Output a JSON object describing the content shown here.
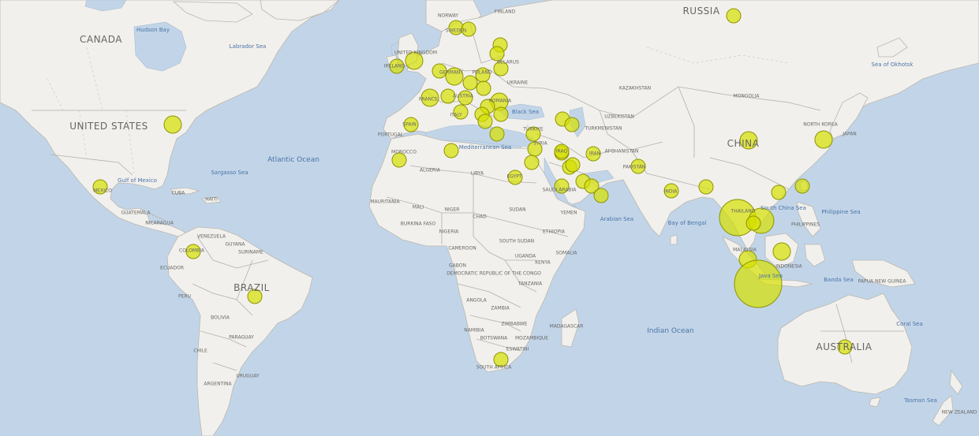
{
  "map": {
    "country_labels": [
      {
        "id": "canada",
        "text": "CANADA",
        "size": "big"
      },
      {
        "id": "united-states",
        "text": "UNITED STATES",
        "size": "big"
      },
      {
        "id": "russia",
        "text": "RUSSIA",
        "size": "big"
      },
      {
        "id": "china",
        "text": "CHINA",
        "size": "big"
      },
      {
        "id": "brazil",
        "text": "BRAZIL",
        "size": "big"
      },
      {
        "id": "australia",
        "text": "AUSTRALIA",
        "size": "big"
      },
      {
        "id": "norway",
        "text": "NORWAY",
        "size": "small"
      },
      {
        "id": "finland",
        "text": "FINLAND",
        "size": "small"
      },
      {
        "id": "sweden",
        "text": "SWEDEN",
        "size": "small"
      },
      {
        "id": "united-kingdom",
        "text": "UNITED KINGDOM",
        "size": "small"
      },
      {
        "id": "ireland",
        "text": "IRELAND",
        "size": "small"
      },
      {
        "id": "germany",
        "text": "GERMANY",
        "size": "small"
      },
      {
        "id": "poland",
        "text": "POLAND",
        "size": "small"
      },
      {
        "id": "belarus",
        "text": "BELARUS",
        "size": "small"
      },
      {
        "id": "ukraine",
        "text": "UKRAINE",
        "size": "small"
      },
      {
        "id": "france",
        "text": "FRANCE",
        "size": "small"
      },
      {
        "id": "austria",
        "text": "AUSTRIA",
        "size": "small"
      },
      {
        "id": "italy",
        "text": "ITALY",
        "size": "small"
      },
      {
        "id": "spain",
        "text": "SPAIN",
        "size": "small"
      },
      {
        "id": "portugal",
        "text": "PORTUGAL",
        "size": "small"
      },
      {
        "id": "romania",
        "text": "ROMANIA",
        "size": "small"
      },
      {
        "id": "turkiye",
        "text": "TÜRKIYE",
        "size": "small"
      },
      {
        "id": "syria",
        "text": "SYRIA",
        "size": "small"
      },
      {
        "id": "iraq",
        "text": "IRAQ",
        "size": "small"
      },
      {
        "id": "iran",
        "text": "IRAN",
        "size": "small"
      },
      {
        "id": "egypt",
        "text": "EGYPT",
        "size": "small"
      },
      {
        "id": "saudi-arabia",
        "text": "SAUDI ARABIA",
        "size": "small"
      },
      {
        "id": "yemen",
        "text": "YEMEN",
        "size": "small"
      },
      {
        "id": "kazakhstan",
        "text": "KAZAKHSTAN",
        "size": "small"
      },
      {
        "id": "uzbekistan",
        "text": "UZBEKISTAN",
        "size": "small"
      },
      {
        "id": "turkmenistan",
        "text": "TURKMENISTAN",
        "size": "small"
      },
      {
        "id": "afghanistan",
        "text": "AFGHANISTAN",
        "size": "small"
      },
      {
        "id": "pakistan",
        "text": "PAKISTAN",
        "size": "small"
      },
      {
        "id": "india",
        "text": "INDIA",
        "size": "small"
      },
      {
        "id": "mongolia",
        "text": "MONGOLIA",
        "size": "small"
      },
      {
        "id": "north-korea",
        "text": "NORTH KOREA",
        "size": "small"
      },
      {
        "id": "japan",
        "text": "JAPAN",
        "size": "small"
      },
      {
        "id": "thailand",
        "text": "THAILAND",
        "size": "small"
      },
      {
        "id": "malaysia",
        "text": "MALAYSIA",
        "size": "small"
      },
      {
        "id": "philippines",
        "text": "PHILIPPINES",
        "size": "small"
      },
      {
        "id": "indonesia",
        "text": "INDONESIA",
        "size": "small"
      },
      {
        "id": "papua-new-guinea",
        "text": "PAPUA NEW GUINEA",
        "size": "small"
      },
      {
        "id": "new-zealand",
        "text": "NEW ZEALAND",
        "size": "small"
      },
      {
        "id": "morocco",
        "text": "MOROCCO",
        "size": "small"
      },
      {
        "id": "algeria",
        "text": "ALGERIA",
        "size": "small"
      },
      {
        "id": "libya",
        "text": "LIBYA",
        "size": "small"
      },
      {
        "id": "mauritania",
        "text": "MAURITANIA",
        "size": "small"
      },
      {
        "id": "mali",
        "text": "MALI",
        "size": "small"
      },
      {
        "id": "niger",
        "text": "NIGER",
        "size": "small"
      },
      {
        "id": "chad",
        "text": "CHAD",
        "size": "small"
      },
      {
        "id": "sudan",
        "text": "SUDAN",
        "size": "small"
      },
      {
        "id": "burkina-faso",
        "text": "BURKINA FASO",
        "size": "small"
      },
      {
        "id": "nigeria",
        "text": "NIGERIA",
        "size": "small"
      },
      {
        "id": "cameroon",
        "text": "CAMEROON",
        "size": "small"
      },
      {
        "id": "south-sudan",
        "text": "SOUTH SUDAN",
        "size": "small"
      },
      {
        "id": "ethiopia",
        "text": "ETHIOPIA",
        "size": "small"
      },
      {
        "id": "somalia",
        "text": "SOMALIA",
        "size": "small"
      },
      {
        "id": "uganda",
        "text": "UGANDA",
        "size": "small"
      },
      {
        "id": "kenya",
        "text": "KENYA",
        "size": "small"
      },
      {
        "id": "gabon",
        "text": "GABON",
        "size": "small"
      },
      {
        "id": "drc",
        "text": "DEMOCRATIC REPUBLIC OF THE CONGO",
        "size": "small"
      },
      {
        "id": "tanzania",
        "text": "TANZANIA",
        "size": "small"
      },
      {
        "id": "angola",
        "text": "ANGOLA",
        "size": "small"
      },
      {
        "id": "zambia",
        "text": "ZAMBIA",
        "size": "small"
      },
      {
        "id": "zimbabwe",
        "text": "ZIMBABWE",
        "size": "small"
      },
      {
        "id": "mozambique",
        "text": "MOZAMBIQUE",
        "size": "small"
      },
      {
        "id": "madagascar",
        "text": "MADAGASCAR",
        "size": "small"
      },
      {
        "id": "namibia",
        "text": "NAMIBIA",
        "size": "small"
      },
      {
        "id": "botswana",
        "text": "BOTSWANA",
        "size": "small"
      },
      {
        "id": "eswatini",
        "text": "ESWATINI",
        "size": "small"
      },
      {
        "id": "south-africa",
        "text": "SOUTH AFRICA",
        "size": "small"
      },
      {
        "id": "mexico",
        "text": "MEXICO",
        "size": "small"
      },
      {
        "id": "cuba",
        "text": "CUBA",
        "size": "small"
      },
      {
        "id": "haiti",
        "text": "HAITI",
        "size": "small"
      },
      {
        "id": "guatemala",
        "text": "GUATEMALA",
        "size": "small"
      },
      {
        "id": "nicaragua",
        "text": "NICARAGUA",
        "size": "small"
      },
      {
        "id": "venezuela",
        "text": "VENEZUELA",
        "size": "small"
      },
      {
        "id": "guyana",
        "text": "GUYANA",
        "size": "small"
      },
      {
        "id": "suriname",
        "text": "SURINAME",
        "size": "small"
      },
      {
        "id": "colombia",
        "text": "COLOMBIA",
        "size": "small"
      },
      {
        "id": "ecuador",
        "text": "ECUADOR",
        "size": "small"
      },
      {
        "id": "peru",
        "text": "PERU",
        "size": "small"
      },
      {
        "id": "bolivia",
        "text": "BOLIVIA",
        "size": "small"
      },
      {
        "id": "paraguay",
        "text": "PARAGUAY",
        "size": "small"
      },
      {
        "id": "chile",
        "text": "CHILE",
        "size": "small"
      },
      {
        "id": "argentina",
        "text": "ARGENTINA",
        "size": "small"
      },
      {
        "id": "uruguay",
        "text": "URUGUAY",
        "size": "small"
      }
    ],
    "water_labels": [
      {
        "id": "hudson-bay",
        "text": "Hudson Bay",
        "size": "water"
      },
      {
        "id": "labrador-sea",
        "text": "Labrador Sea",
        "size": "water"
      },
      {
        "id": "atlantic-ocean",
        "text": "Atlantic Ocean",
        "size": "ocean"
      },
      {
        "id": "sargasso-sea",
        "text": "Sargasso Sea",
        "size": "water"
      },
      {
        "id": "gulf-of-mexico",
        "text": "Gulf of Mexico",
        "size": "water"
      },
      {
        "id": "black-sea",
        "text": "Black Sea",
        "size": "water"
      },
      {
        "id": "mediterranean-sea",
        "text": "Mediterranean Sea",
        "size": "water"
      },
      {
        "id": "arabian-sea",
        "text": "Arabian Sea",
        "size": "water"
      },
      {
        "id": "bay-of-bengal",
        "text": "Bay of Bengal",
        "size": "water"
      },
      {
        "id": "south-china-sea",
        "text": "South China Sea",
        "size": "water"
      },
      {
        "id": "philippine-sea",
        "text": "Philippine Sea",
        "size": "water"
      },
      {
        "id": "sea-of-okhotsk",
        "text": "Sea of Okhotsk",
        "size": "water"
      },
      {
        "id": "java-sea",
        "text": "Java Sea",
        "size": "water"
      },
      {
        "id": "banda-sea",
        "text": "Banda Sea",
        "size": "water"
      },
      {
        "id": "indian-ocean",
        "text": "Indian Ocean",
        "size": "ocean"
      },
      {
        "id": "coral-sea",
        "text": "Coral Sea",
        "size": "water"
      },
      {
        "id": "tasman-sea",
        "text": "Tasman Sea",
        "size": "water"
      }
    ],
    "bubbles": [
      {
        "id": "usa",
        "size": 3
      },
      {
        "id": "mexico",
        "size": 2
      },
      {
        "id": "colombia",
        "size": 2
      },
      {
        "id": "brazil",
        "size": 2
      },
      {
        "id": "russia",
        "size": 2
      },
      {
        "id": "norway",
        "size": 2
      },
      {
        "id": "sweden",
        "size": 2
      },
      {
        "id": "finland",
        "size": 2
      },
      {
        "id": "baltic",
        "size": 2
      },
      {
        "id": "belarus",
        "size": 2
      },
      {
        "id": "ireland",
        "size": 2
      },
      {
        "id": "uk",
        "size": 3
      },
      {
        "id": "netherlands",
        "size": 2
      },
      {
        "id": "germany",
        "size": 3
      },
      {
        "id": "poland",
        "size": 2
      },
      {
        "id": "czechia",
        "size": 2
      },
      {
        "id": "slovakia",
        "size": 2
      },
      {
        "id": "france",
        "size": 3
      },
      {
        "id": "switzerland",
        "size": 2
      },
      {
        "id": "austria",
        "size": 2
      },
      {
        "id": "romania",
        "size": 3
      },
      {
        "id": "hungary",
        "size": 2
      },
      {
        "id": "serbia",
        "size": 2
      },
      {
        "id": "italy",
        "size": 2
      },
      {
        "id": "balkans",
        "size": 2
      },
      {
        "id": "bulgaria",
        "size": 2
      },
      {
        "id": "greece",
        "size": 2
      },
      {
        "id": "crete",
        "size": 2
      },
      {
        "id": "spain",
        "size": 2
      },
      {
        "id": "morocco",
        "size": 2
      },
      {
        "id": "tunisia",
        "size": 2
      },
      {
        "id": "turkiye",
        "size": 2
      },
      {
        "id": "georgia",
        "size": 2
      },
      {
        "id": "azerbaijan",
        "size": 2
      },
      {
        "id": "syria",
        "size": 2
      },
      {
        "id": "lebanon",
        "size": 2
      },
      {
        "id": "jordan",
        "size": 2
      },
      {
        "id": "iraq",
        "size": 2
      },
      {
        "id": "iran",
        "size": 2
      },
      {
        "id": "egypt",
        "size": 2
      },
      {
        "id": "saudi-arabia",
        "size": 2
      },
      {
        "id": "kuwait",
        "size": 2
      },
      {
        "id": "uae",
        "size": 2
      },
      {
        "id": "oman",
        "size": 2
      },
      {
        "id": "qatar",
        "size": 2
      },
      {
        "id": "pakistan",
        "size": 2
      },
      {
        "id": "india",
        "size": 2
      },
      {
        "id": "bangladesh",
        "size": 2
      },
      {
        "id": "china",
        "size": 3
      },
      {
        "id": "south-korea",
        "size": 3
      },
      {
        "id": "hong-kong",
        "size": 2
      },
      {
        "id": "taiwan",
        "size": 2
      },
      {
        "id": "thailand",
        "size": 6
      },
      {
        "id": "vietnam",
        "size": 4
      },
      {
        "id": "cambodia",
        "size": 2
      },
      {
        "id": "malaysia",
        "size": 3
      },
      {
        "id": "brunei",
        "size": 3
      },
      {
        "id": "indonesia",
        "size": 7
      },
      {
        "id": "south-africa",
        "size": 2
      },
      {
        "id": "australia",
        "size": 2
      }
    ]
  }
}
